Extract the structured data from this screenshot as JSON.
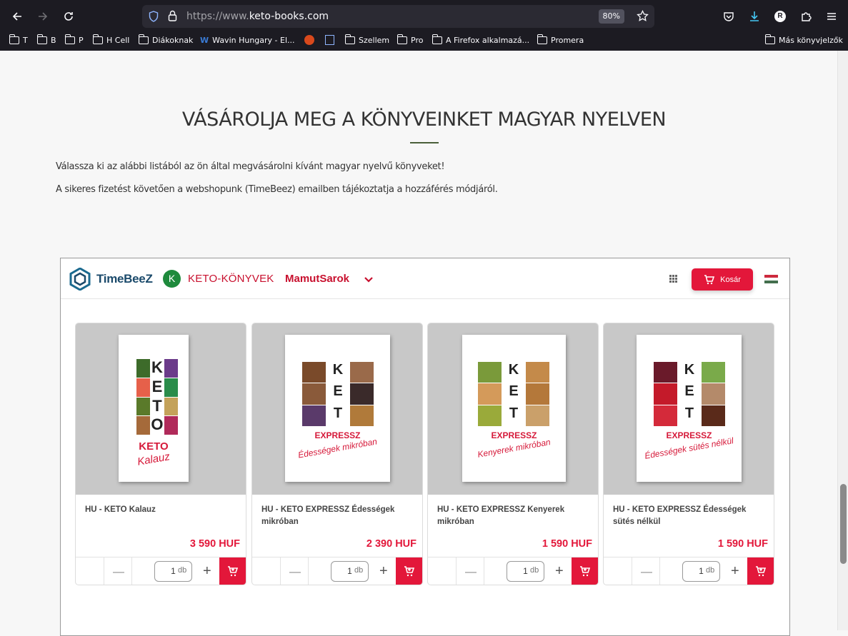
{
  "browser": {
    "url_prefix": "https://www.",
    "url_domain": "keto-books.com",
    "zoom": "80%",
    "profile_initial": "R",
    "bookmarks": [
      {
        "label": "T",
        "type": "folder"
      },
      {
        "label": "B",
        "type": "folder"
      },
      {
        "label": "P",
        "type": "folder"
      },
      {
        "label": "H Cell",
        "type": "folder"
      },
      {
        "label": "Diákoknak",
        "type": "folder"
      },
      {
        "label": "Wavin Hungary - El...",
        "type": "site"
      },
      {
        "label": "",
        "type": "site"
      },
      {
        "label": "",
        "type": "site"
      },
      {
        "label": "Szellem",
        "type": "folder"
      },
      {
        "label": "Pro",
        "type": "folder"
      },
      {
        "label": "A Firefox alkalmazá...",
        "type": "folder"
      },
      {
        "label": "Promera",
        "type": "folder"
      }
    ],
    "other_bookmarks": "Más könyvjelzők"
  },
  "page": {
    "title": "VÁSÁROLJA MEG A KÖNYVEINKET MAGYAR NYELVEN",
    "intro_1": "Válassza ki az alábbi listából az ön által megvásárolni kívánt magyar nyelvű könyveket!",
    "intro_2": "A sikeres fizetést követően a webshopunk (TimeBeez) emailben tájékoztatja a hozzáférés módjáról."
  },
  "shop": {
    "logo": "TimeBeeZ",
    "badge": "K",
    "shop_name": "KETO-KÖNYVEK",
    "mamut": "MamutSarok",
    "cart_label": "Kosár",
    "products": [
      {
        "name": "HU - KETO Kalauz",
        "price": "3 590 HUF",
        "qty": "1",
        "unit": "db",
        "cover_sub": "Kalauz",
        "cover_title": "KETO"
      },
      {
        "name": "HU - KETO EXPRESSZ Édességek mikróban",
        "price": "2 390 HUF",
        "qty": "1",
        "unit": "db",
        "cover_sub": "Édességek mikróban",
        "cover_title": "EXPRESSZ"
      },
      {
        "name": "HU - KETO EXPRESSZ Kenyerek mikróban",
        "price": "1 590 HUF",
        "qty": "1",
        "unit": "db",
        "cover_sub": "Kenyerek mikróban",
        "cover_title": "EXPRESSZ"
      },
      {
        "name": "HU - KETO EXPRESSZ Édességek sütés nélkül",
        "price": "1 590 HUF",
        "qty": "1",
        "unit": "db",
        "cover_sub": "Édességek sütés nélkül",
        "cover_title": "EXPRESSZ"
      }
    ]
  },
  "colors": {
    "accent": "#e3173a",
    "brand_blue": "#1b4a6b",
    "k_green": "#1e8a3c",
    "title_rule": "#4a5f3a"
  }
}
